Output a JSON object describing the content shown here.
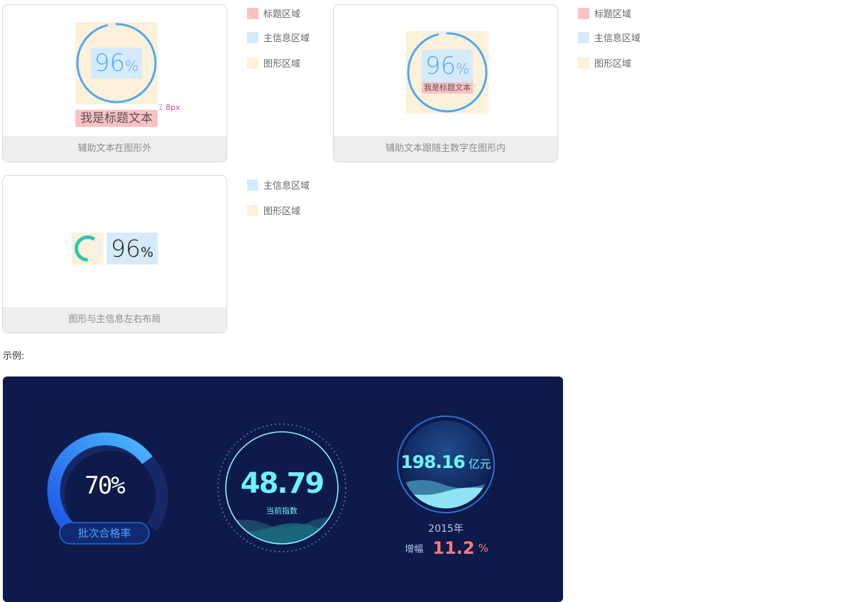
{
  "legend": {
    "title_area": "标题区域",
    "main_info_area": "主信息区域",
    "graphic_area": "图形区域"
  },
  "card1": {
    "number": "96",
    "unit": "%",
    "title": "我是标题文本",
    "spacing_note": "8px",
    "footer": "辅助文本在图形外"
  },
  "card2": {
    "number": "96",
    "unit": "%",
    "title": "我是标题文本",
    "footer": "辅助文本跟随主数字在图形内"
  },
  "card3": {
    "number": "96",
    "unit": "%",
    "footer": "图形与主信息左右布局"
  },
  "example_label": "示例:",
  "dashboard": {
    "gauge": {
      "value": "70%",
      "label": "批次合格率",
      "progress": 0.7
    },
    "index": {
      "value": "48.79",
      "label": "当前指数"
    },
    "amount": {
      "value": "198.16",
      "unit": "亿元",
      "year": "2015年",
      "growth_label": "增幅",
      "growth_value": "11.2",
      "growth_unit": "%"
    }
  },
  "colors": {
    "title_area": "#fdc1c4",
    "main_info_area": "#d5ebfb",
    "graphic_area": "#fdf1d9",
    "ring_blue": "#4ea8f5",
    "ring_teal": "#2ec7b6",
    "dashboard_bg": "#0d1a4a",
    "cyan_text": "#6ff2ff",
    "growth_red": "#ff7b7b"
  }
}
